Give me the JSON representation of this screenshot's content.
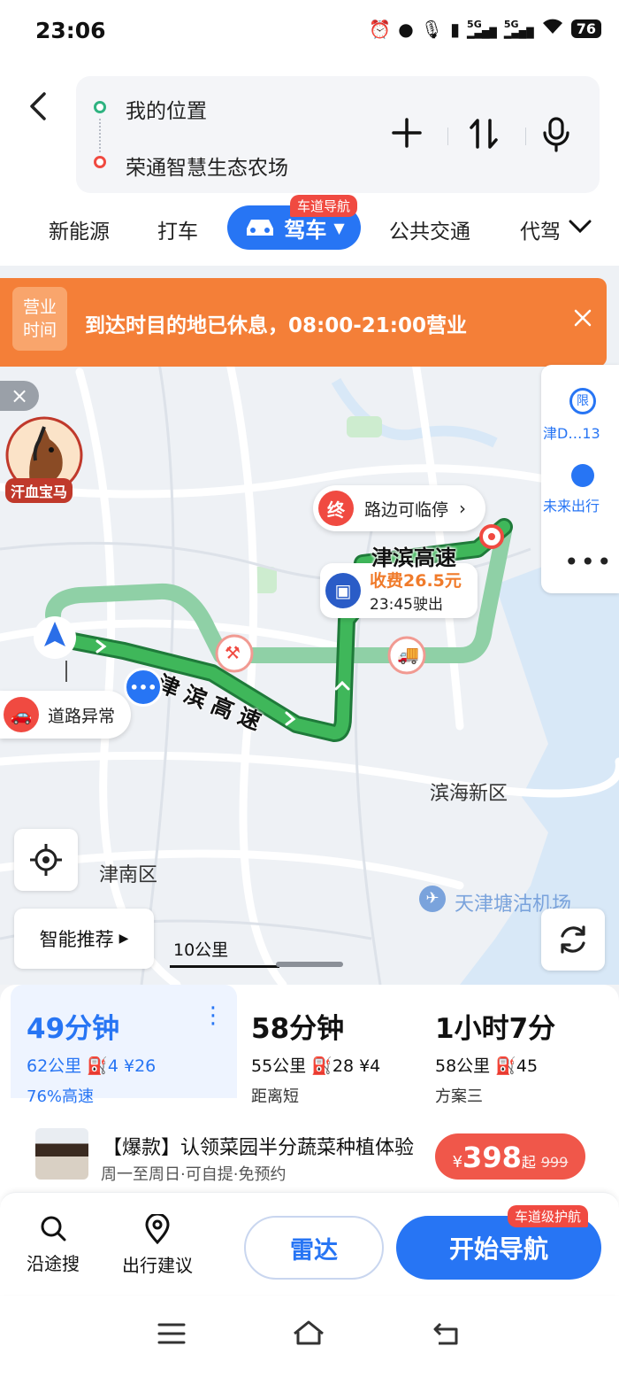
{
  "status_bar": {
    "time": "23:06",
    "battery": "76",
    "net1": "5G",
    "net2": "5G"
  },
  "header": {
    "origin": "我的位置",
    "destination": "荣通智慧生态农场",
    "tabs": [
      "新能源",
      "打车",
      "驾车",
      "公共交通",
      "代驾"
    ],
    "active_tab_badge": "车道导航"
  },
  "map": {
    "banner": {
      "tag_line1": "营业",
      "tag_line2": "时间",
      "message": "到达时目的地已休息，08:00-21:00营业"
    },
    "side_panel": {
      "plate": "津D…13",
      "plate_badge": "限",
      "future": "未来出行",
      "more": "•••"
    },
    "horse_label": "汗血宝马",
    "end_marker": {
      "badge": "终",
      "text": "路边可临停"
    },
    "toll": {
      "fee": "收费26.5元",
      "exit": "23:45驶出"
    },
    "incident": "道路异常",
    "road_names": [
      "津滨高速",
      "津滨高速"
    ],
    "districts": {
      "binhai": "滨海新区",
      "jinnan": "津南区"
    },
    "airport": "天津塘沽机场",
    "smart_recommend": "智能推荐",
    "scale": "10公里",
    "colors": {
      "route_main": "#3fb75a",
      "route_alt": "#8fd0a6",
      "water": "#d8e8f7",
      "banner": "#f47f38"
    }
  },
  "routes": [
    {
      "time": "49分钟",
      "detail": "62公里  ⛽4  ¥26",
      "sub": "76%高速",
      "selected": true
    },
    {
      "time": "58分钟",
      "detail": "55公里  ⛽28  ¥4",
      "sub": "距离短",
      "selected": false
    },
    {
      "time": "1小时7分",
      "detail": "58公里  ⛽45",
      "sub": "方案三",
      "selected": false
    }
  ],
  "ad": {
    "title": "【爆款】认领菜园半分蔬菜种植体验",
    "sub": "周一至周日·可自提·免预约",
    "currency": "¥",
    "price": "398",
    "price_suffix": "起",
    "old_price": "999"
  },
  "actions": {
    "search_along": "沿途搜",
    "advice": "出行建议",
    "radar": "雷达",
    "start": "开始导航",
    "start_badge": "车道级护航"
  }
}
